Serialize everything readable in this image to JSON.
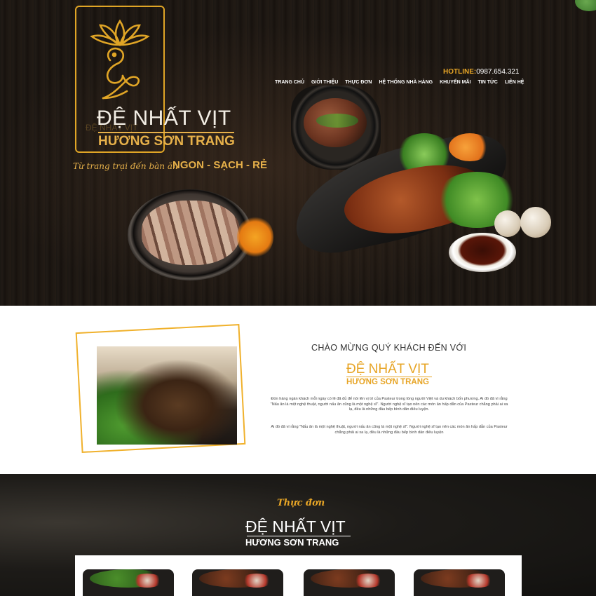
{
  "header": {
    "brand_name": "ĐỆ NHẤT VỊT",
    "brand_sub": "HƯƠNG SƠN TRANG",
    "tagline": "Từ trang trại đến bàn ăn",
    "tagline_strong": "NGON - SẠCH - RẺ",
    "hotline_label": "HOTLINE:",
    "hotline_number": "0987.654.321",
    "nav": [
      {
        "label": "TRANG CHỦ"
      },
      {
        "label": "GIỚI THIỆU"
      },
      {
        "label": "THỰC ĐƠN"
      },
      {
        "label": "HỆ THỐNG NHÀ HÀNG"
      },
      {
        "label": "KHUYẾN MÃI"
      },
      {
        "label": "TIN TỨC"
      },
      {
        "label": "LIÊN HỆ"
      }
    ]
  },
  "welcome": {
    "title": "CHÀO MỪNG QUÝ KHÁCH ĐẾN VỚI",
    "brand_name": "ĐỆ NHẤT VỊT",
    "brand_sub": "HƯƠNG SƠN TRANG",
    "paragraph1": "Đón hàng ngàn khách mỗi ngày có lẽ đã đủ để nói lên vị trí của Pasteur trong lòng người Việt và du khách bốn phương. Ai đó đã vì rằng \"Nấu ăn là một nghệ thuật, người nấu ăn cũng là một nghệ sĩ\". Người nghệ sĩ tạo nên các món ăn hấp dẫn của Pasteur chẳng phải ai xa lạ, đều là những đầu bếp bình dân điêu luyện.",
    "paragraph2": "Ai đó đã ví rằng \"Nấu ăn là một nghệ thuật, người nấu ăn cũng là một nghệ sĩ\". Người nghệ sĩ tạo nên các món ăn hấp dẫn của Pasteur chẳng phải ai xa lạ, đều là những đầu bếp bình dân điêu luyện"
  },
  "menu": {
    "heading": "Thực đơn",
    "brand_name": "ĐỆ NHẤT VỊT",
    "brand_sub": "HƯƠNG SƠN TRANG"
  },
  "colors": {
    "accent": "#e7a526",
    "dark_bg": "#1b1510"
  }
}
